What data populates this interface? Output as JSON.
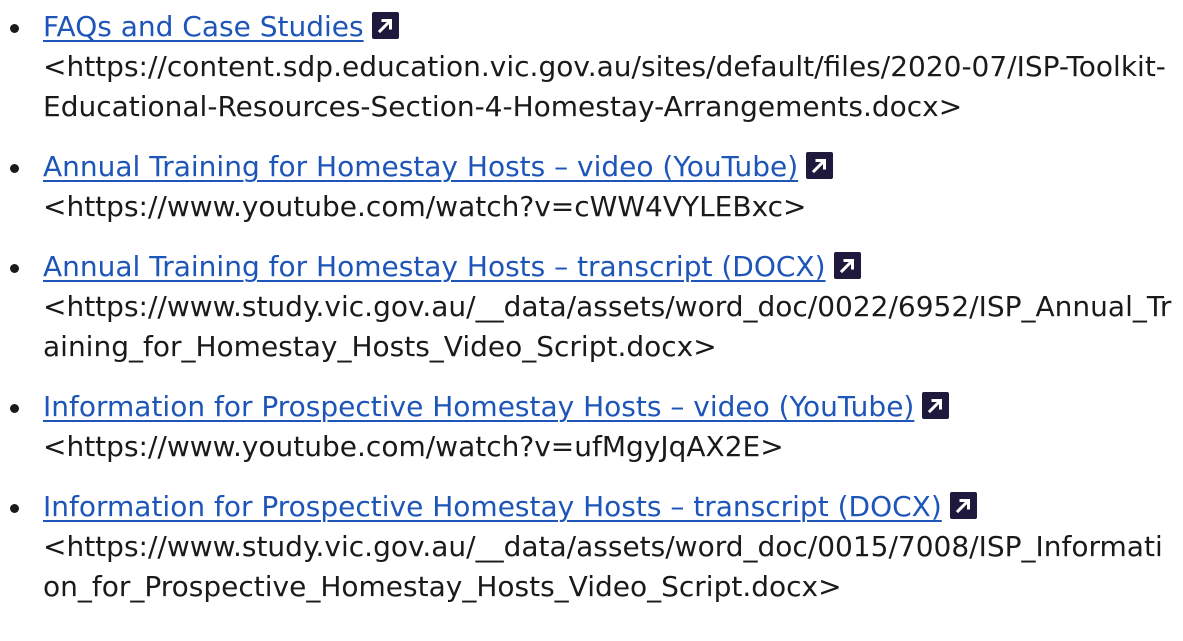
{
  "resources": [
    {
      "link_text": "FAQs and Case Studies",
      "url_text": "<https://content.sdp.education.vic.gov.au/sites/default/files/2020-07/ISP-Toolkit-Educational-Resources-Section-4-Homestay-Arrangements.docx>",
      "icon": "external-link-icon"
    },
    {
      "link_text": "Annual Training for Homestay Hosts – video (YouTube)",
      "url_text": "<https://www.youtube.com/watch?v=cWW4VYLEBxc>",
      "icon": "external-link-icon"
    },
    {
      "link_text": "Annual Training for Homestay Hosts – transcript (DOCX)",
      "url_text": "<https://www.study.vic.gov.au/__data/assets/word_doc/0022/6952/ISP_Annual_Training_for_Homestay_Hosts_Video_Script.docx>",
      "icon": "external-link-icon"
    },
    {
      "link_text": "Information for Prospective Homestay Hosts – video (YouTube)",
      "url_text": "<https://www.youtube.com/watch?v=ufMgyJqAX2E>",
      "icon": "external-link-icon"
    },
    {
      "link_text": "Information for Prospective Homestay Hosts – transcript (DOCX)",
      "url_text": "<https://www.study.vic.gov.au/__data/assets/word_doc/0015/7008/ISP_Information_for_Prospective_Homestay_Hosts_Video_Script.docx>",
      "icon": "external-link-icon"
    }
  ],
  "colors": {
    "link": "#1e55b8",
    "text": "#1a1a1a",
    "icon_bg": "#1f1a3d"
  }
}
